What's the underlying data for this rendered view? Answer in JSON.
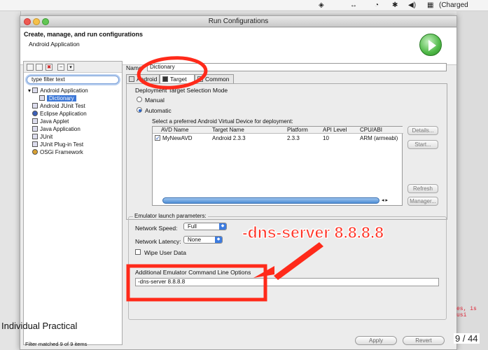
{
  "menubar": {
    "right_items": [
      "↔",
      "◔",
      "✱",
      "Charged"
    ],
    "battery_text": "(Charged"
  },
  "window": {
    "title": "Run Configurations",
    "header_title": "Create, manage, and run configurations",
    "header_subtitle": "Android Application"
  },
  "left_pane": {
    "filter_placeholder": "type filter text",
    "tree": [
      {
        "label": "Android Application",
        "level": 0
      },
      {
        "label": "Dictionary",
        "level": 1,
        "selected": true
      },
      {
        "label": "Android JUnit Test",
        "level": 0
      },
      {
        "label": "Eclipse Application",
        "level": 0
      },
      {
        "label": "Java Applet",
        "level": 0
      },
      {
        "label": "Java Application",
        "level": 0
      },
      {
        "label": "JUnit",
        "level": 0
      },
      {
        "label": "JUnit Plug-in Test",
        "level": 0
      },
      {
        "label": "OSGi Framework",
        "level": 0
      }
    ],
    "status": "Filter matched 9 of 9 items"
  },
  "config": {
    "name_label": "Name:",
    "name_value": "Dictionary",
    "tabs": [
      "Android",
      "Target",
      "Common"
    ],
    "selected_tab": "Target",
    "deployment_label": "Deployment Target Selection Mode",
    "manual_label": "Manual",
    "automatic_label": "Automatic",
    "select_avd_label": "Select a preferred Android Virtual Device for deployment:",
    "avd_columns": [
      "AVD Name",
      "Target Name",
      "Platform",
      "API Level",
      "CPU/ABI"
    ],
    "avd_row": {
      "checked": true,
      "name": "MyNewAVD",
      "target": "Android 2.3.3",
      "platform": "2.3.3",
      "api": "10",
      "cpu": "ARM (armeabi)"
    },
    "side_buttons": [
      "Details...",
      "Start...",
      "Refresh",
      "Manager..."
    ]
  },
  "emulator": {
    "group_label": "Emulator launch parameters:",
    "network_speed_label": "Network Speed:",
    "network_speed_value": "Full",
    "network_latency_label": "Network Latency:",
    "network_latency_value": "None",
    "wipe_label": "Wipe User Data",
    "addl_label": "Additional Emulator Command Line Options",
    "addl_value": "-dns-server 8.8.8.8"
  },
  "annotation": {
    "callout_text": "-dns-server 8.8.8.8",
    "color": "#ff2a1a"
  },
  "footer": {
    "apply": "Apply",
    "revert": "Revert",
    "slide_text": "Individual Practical",
    "page_num": "9 / 44",
    "code_fragment": "es, is usi"
  }
}
